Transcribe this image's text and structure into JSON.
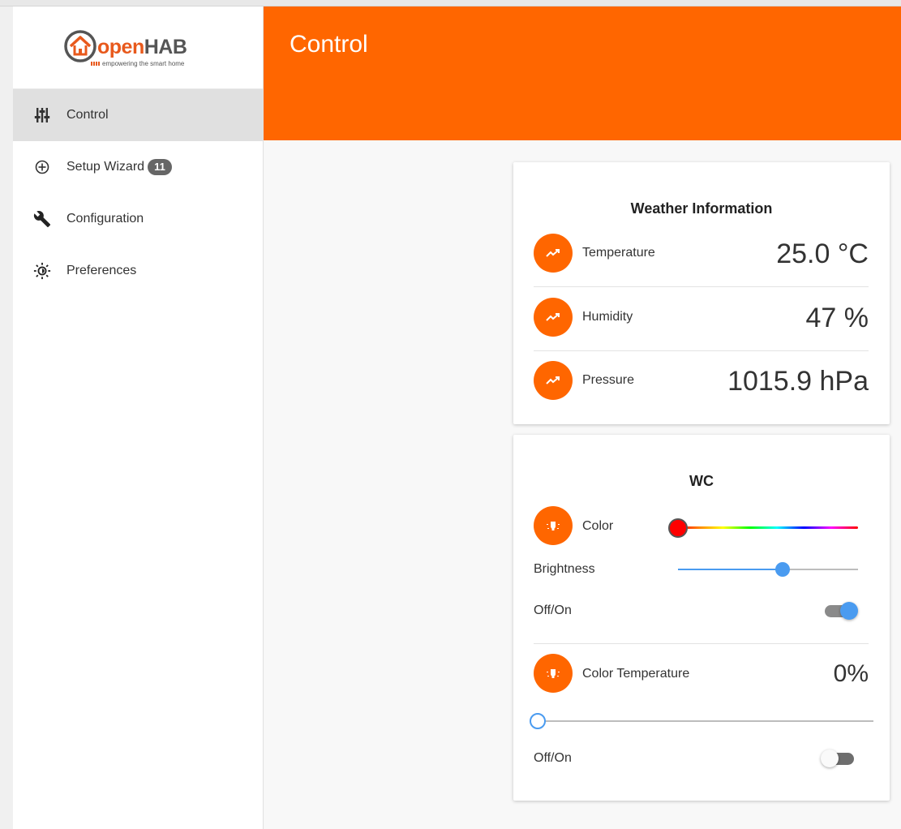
{
  "logo": {
    "word_open": "open",
    "word_hab": "HAB",
    "tagline": "empowering the smart home",
    "brand_color": "#e8591c"
  },
  "sidebar": {
    "items": [
      {
        "label": "Control",
        "icon": "sliders-icon",
        "active": true
      },
      {
        "label": "Setup Wizard",
        "icon": "add-circle-icon",
        "badge": "11"
      },
      {
        "label": "Configuration",
        "icon": "wrench-icon"
      },
      {
        "label": "Preferences",
        "icon": "brightness-icon"
      }
    ]
  },
  "header": {
    "title": "Control",
    "color": "#ff6600"
  },
  "weather_card": {
    "title": "Weather Information",
    "rows": [
      {
        "label": "Temperature",
        "value": "25.0 °C",
        "icon": "trend-icon"
      },
      {
        "label": "Humidity",
        "value": "47 %",
        "icon": "trend-icon"
      },
      {
        "label": "Pressure",
        "value": "1015.9 hPa",
        "icon": "trend-icon"
      }
    ]
  },
  "wc_card": {
    "title": "WC",
    "color_label": "Color",
    "color_value": "#ff0000",
    "brightness_label": "Brightness",
    "brightness_level": 0.58,
    "switch1_label": "Off/On",
    "switch1_on": true,
    "color_temp_label": "Color Temperature",
    "color_temp_value": "0%",
    "color_temp_level": 0,
    "switch2_label": "Off/On",
    "switch2_on": false,
    "accent_color": "#4a9bf0"
  }
}
